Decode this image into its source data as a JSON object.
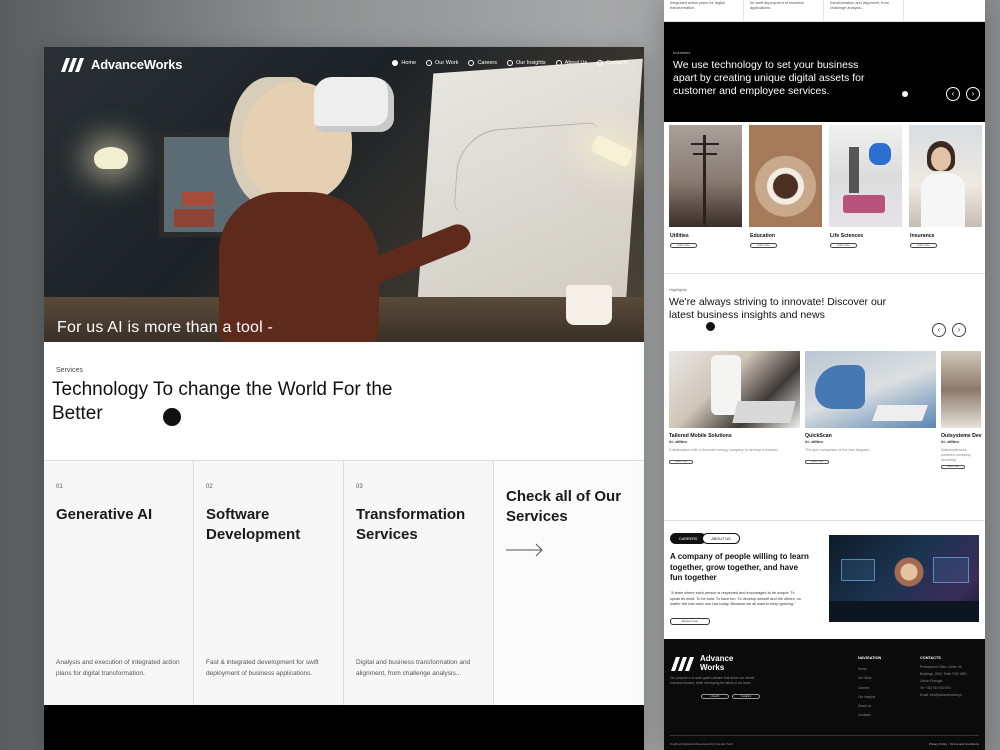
{
  "brand": {
    "name": "AdvanceWorks",
    "name_line1": "Advance",
    "name_line2": "Works"
  },
  "left": {
    "nav": [
      {
        "label": "Home",
        "active": true
      },
      {
        "label": "Our Work",
        "active": false
      },
      {
        "label": "Careers",
        "active": false
      },
      {
        "label": "Our Insights",
        "active": false
      },
      {
        "label": "About Us",
        "active": false
      },
      {
        "label": "Contacts",
        "active": false
      }
    ],
    "hero_caption": "For us AI is more than a tool -",
    "services": {
      "eyebrow": "Services",
      "headline": "Technology To change the World For the Better"
    },
    "cards": [
      {
        "num": "01",
        "title": "Generative AI",
        "desc": "Analysis and execution of integrated action plans for digital transformation."
      },
      {
        "num": "02",
        "title": "Software Development",
        "desc": "Fast & integrated development for swift deployment of business applications."
      },
      {
        "num": "03",
        "title": "Transformation Services",
        "desc": "Digital and business transformation and alignment, from challenge analysis..."
      }
    ],
    "cta": "Check all of Our Services"
  },
  "right": {
    "top_cols": [
      "integrated action plans for digital transformation.",
      "for swift deployment of business applications.",
      "transformation and alignment, from challenge analysis..."
    ],
    "industries": {
      "eyebrow": "Industries",
      "headline": "We use technology to set your business apart by creating unique digital assets for customer and employee services.",
      "items": [
        {
          "label": "Utilities",
          "btn": "Learn more"
        },
        {
          "label": "Education",
          "btn": "Learn more"
        },
        {
          "label": "Life Sciences",
          "btn": "Learn more"
        },
        {
          "label": "Insurance",
          "btn": "Learn more"
        }
      ]
    },
    "highlights": {
      "eyebrow": "Highlights",
      "headline": "We're always striving to innovate! Discover our latest business insights and news",
      "items": [
        {
          "title": "Tailored Mobile Solutions",
          "sub": "AI, utilities",
          "desc": "Collaboration with a Denmark energy company to develop a solution",
          "btn": "Learn more"
        },
        {
          "title": "QuickScan",
          "sub": "AI, utilities",
          "desc": "The quiz companion of the new kingdom",
          "btn": "Learn more"
        },
        {
          "title": "Outsystems Dev",
          "sub": "AI, utilities",
          "desc": "Nationwideness powered company recruiting",
          "btn": "Learn more"
        }
      ]
    },
    "careers": {
      "tabs": [
        "CAREERS",
        "ABOUT US"
      ],
      "headline": "A company of people willing to learn together, grow together, and have fun together",
      "quote": "\"A team where each person is respected and encouraged to be unique. To speak its mind. To be bold. To have fun. To develop oneself and the others, no matter the role each one has today. Because we all want to keep growing.\"",
      "btn": "Discover more"
    },
    "footer": {
      "desc": "Our purpose is to work great software that drives our clients' business forward, while developing the talent of our team",
      "btns": [
        "LinkedIn",
        "Instagram"
      ],
      "nav_title": "NAVIGATION",
      "nav": [
        "Home",
        "Our Work",
        "Careers",
        "Our Insights",
        "About Us",
        "Contacts"
      ],
      "contacts_title": "CONTACTS",
      "contacts": [
        "Professional Office Center 4b",
        "Buildings, 2000, Tbilis 7000 4961",
        "Lisbon Portugal",
        "Tel +351 910 000 000",
        "Email: info@advanceworks.pt"
      ],
      "bottom_left": "Crafting Digital and Developed by Domain Tech",
      "bottom_right": "Privacy Policy · Terms and Conditions"
    }
  }
}
